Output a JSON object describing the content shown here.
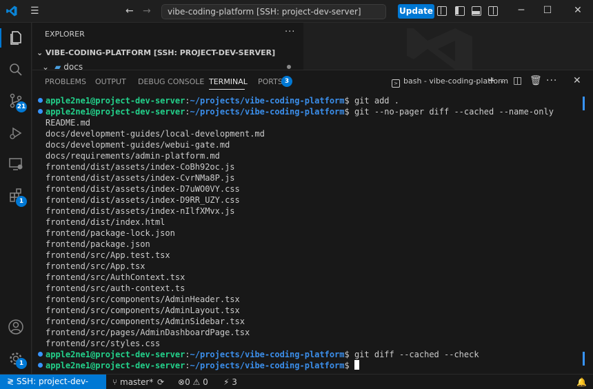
{
  "titlebar": {
    "command_center": "vibe-coding-platform [SSH: project-dev-server]",
    "update_label": "Update"
  },
  "activity": {
    "scm_badge": "21",
    "extensions_badge": "1",
    "manage_badge": "1"
  },
  "explorer": {
    "title": "EXPLORER",
    "more": "···",
    "workspace": "VIBE-CODING-PLATFORM [SSH: PROJECT-DEV-SERVER]",
    "folder": "docs"
  },
  "panel": {
    "tabs": [
      "PROBLEMS",
      "OUTPUT",
      "DEBUG CONSOLE",
      "TERMINAL",
      "PORTS"
    ],
    "ports_badge": "3",
    "terminal_name": "bash - vibe-coding-platform"
  },
  "terminal": {
    "user": "apple2ne1@project-dev-server",
    "path": "~/projects/vibe-coding-platform",
    "cmd1": "git add .",
    "cmd2": "git --no-pager diff --cached --name-only",
    "files": [
      "README.md",
      "docs/development-guides/local-development.md",
      "docs/development-guides/webui-gate.md",
      "docs/requirements/admin-platform.md",
      "frontend/dist/assets/index-CoBh92oc.js",
      "frontend/dist/assets/index-CvrNMa8P.js",
      "frontend/dist/assets/index-D7uWO0VY.css",
      "frontend/dist/assets/index-D9RR_UZY.css",
      "frontend/dist/assets/index-nIlfXMvx.js",
      "frontend/dist/index.html",
      "frontend/package-lock.json",
      "frontend/package.json",
      "frontend/src/App.test.tsx",
      "frontend/src/App.tsx",
      "frontend/src/AuthContext.tsx",
      "frontend/src/auth-context.ts",
      "frontend/src/components/AdminHeader.tsx",
      "frontend/src/components/AdminLayout.tsx",
      "frontend/src/components/AdminSidebar.tsx",
      "frontend/src/pages/AdminDashboardPage.tsx",
      "frontend/src/styles.css"
    ],
    "cmd3": "git diff --cached --check"
  },
  "statusbar": {
    "remote": "SSH: project-dev-server",
    "branch": "master*",
    "errors": "0",
    "warnings": "0",
    "ports": "3"
  },
  "colors": {
    "accent": "#0078d4",
    "prompt_user": "#23d18b",
    "prompt_path": "#3b8eea"
  }
}
